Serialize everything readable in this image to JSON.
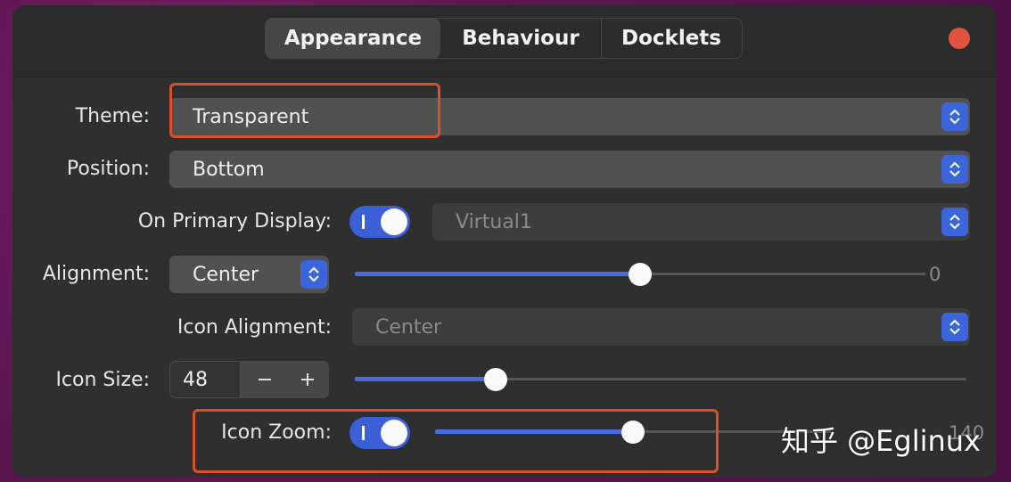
{
  "tabs": [
    {
      "label": "Appearance",
      "active": true
    },
    {
      "label": "Behaviour",
      "active": false
    },
    {
      "label": "Docklets",
      "active": false
    }
  ],
  "theme": {
    "label": "Theme:",
    "value": "Transparent"
  },
  "position": {
    "label": "Position:",
    "value": "Bottom"
  },
  "primary_display": {
    "label": "On Primary Display:",
    "toggle_on": true,
    "value": "Virtual1"
  },
  "alignment": {
    "label": "Alignment:",
    "value": "Center",
    "offset_value": "0",
    "offset_fraction": 0.5
  },
  "icon_alignment": {
    "label": "Icon Alignment:",
    "value": "Center"
  },
  "icon_size": {
    "label": "Icon Size:",
    "value": "48",
    "slider_fraction": 0.23
  },
  "icon_zoom": {
    "label": "Icon Zoom:",
    "toggle_on": true,
    "value_partial": "140",
    "slider_fraction": 0.5
  },
  "watermark": "知乎 @Eglinux",
  "colors": {
    "accent": "#3a5fd6",
    "highlight": "#d9502f",
    "close": "#e0533c"
  }
}
